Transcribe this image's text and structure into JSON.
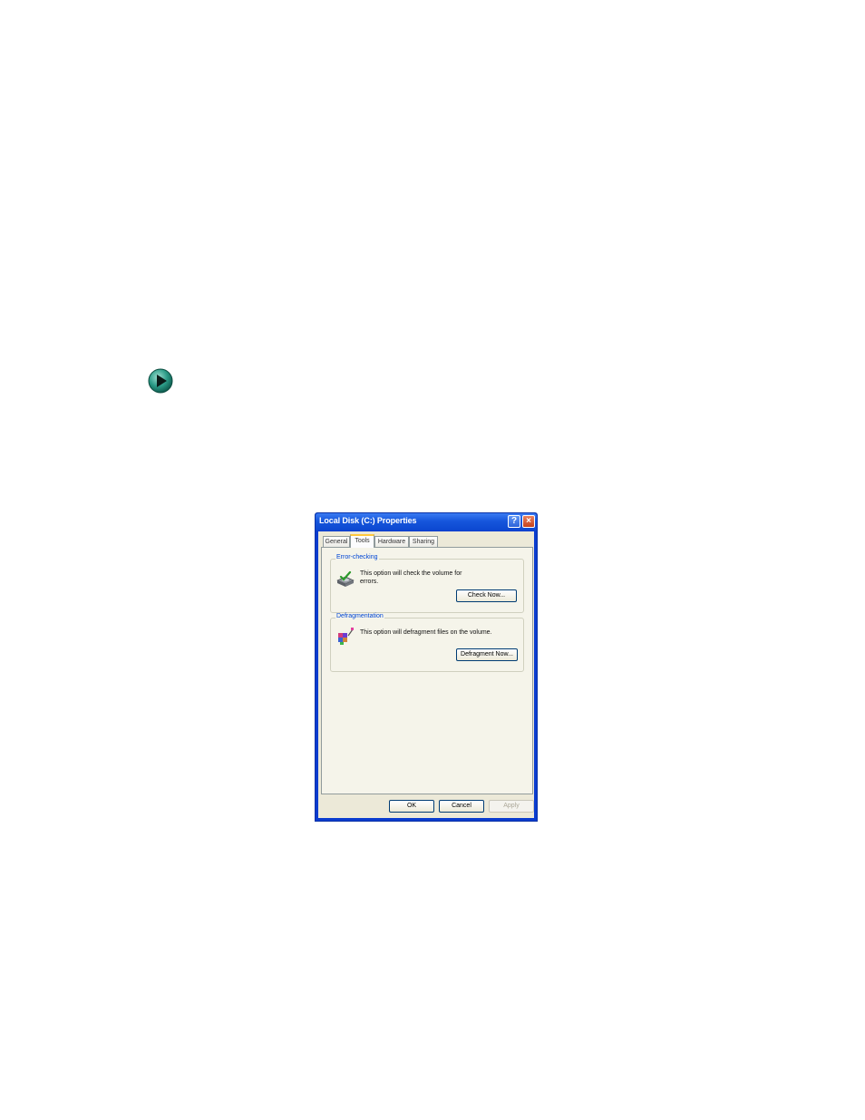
{
  "dialog": {
    "title": "Local Disk (C:) Properties",
    "help_button": "?",
    "close_button": "×"
  },
  "tabs": [
    {
      "label": "General"
    },
    {
      "label": "Tools"
    },
    {
      "label": "Hardware"
    },
    {
      "label": "Sharing"
    }
  ],
  "error_checking": {
    "group_label": "Error-checking",
    "description": "This option will check the volume for errors.",
    "button_label": "Check Now..."
  },
  "defragmentation": {
    "group_label": "Defragmentation",
    "description": "This option will defragment files on the volume.",
    "button_label": "Defragment Now..."
  },
  "footer": {
    "ok_label": "OK",
    "cancel_label": "Cancel",
    "apply_label": "Apply"
  },
  "colors": {
    "titlebar": "#1656dc",
    "group_label": "#0046d5",
    "active_tab_accent": "#ffc83c"
  }
}
